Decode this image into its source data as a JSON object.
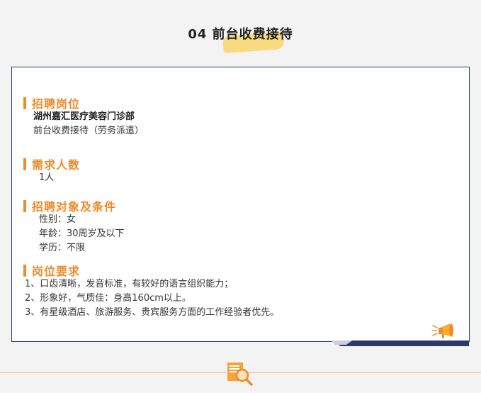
{
  "header": {
    "title": "04 前台收费接待"
  },
  "sections": [
    {
      "title": "招聘岗位",
      "lines": [
        {
          "text": "湖州嘉汇医疗美容门诊部",
          "bold": true
        },
        {
          "text": "前台收费接待（劳务派遣）",
          "bold": false
        }
      ]
    },
    {
      "title": "需求人数",
      "lines": [
        {
          "text": "1人",
          "bold": false
        }
      ]
    },
    {
      "title": "招聘对象及条件",
      "lines": [
        {
          "text": "性别：女",
          "bold": false
        },
        {
          "text": "年龄：30周岁及以下",
          "bold": false
        },
        {
          "text": "学历：不限",
          "bold": false
        }
      ]
    },
    {
      "title": "岗位要求",
      "lines": [
        {
          "text": "1、口齿清晰，发音标准，有较好的语言组织能力；",
          "bold": false
        },
        {
          "text": "2、形象好，气质佳：身高160cm以上。",
          "bold": false
        },
        {
          "text": "3、有星级酒店、旅游服务、贵宾服务方面的工作经验者优先。",
          "bold": false
        }
      ]
    }
  ],
  "colors": {
    "accent": "#f08a2a",
    "highlight": "#f8d56a",
    "border": "#2b3a6a",
    "background": "#f3f3f3"
  },
  "icons": [
    "megaphone-icon",
    "document-search-icon"
  ]
}
